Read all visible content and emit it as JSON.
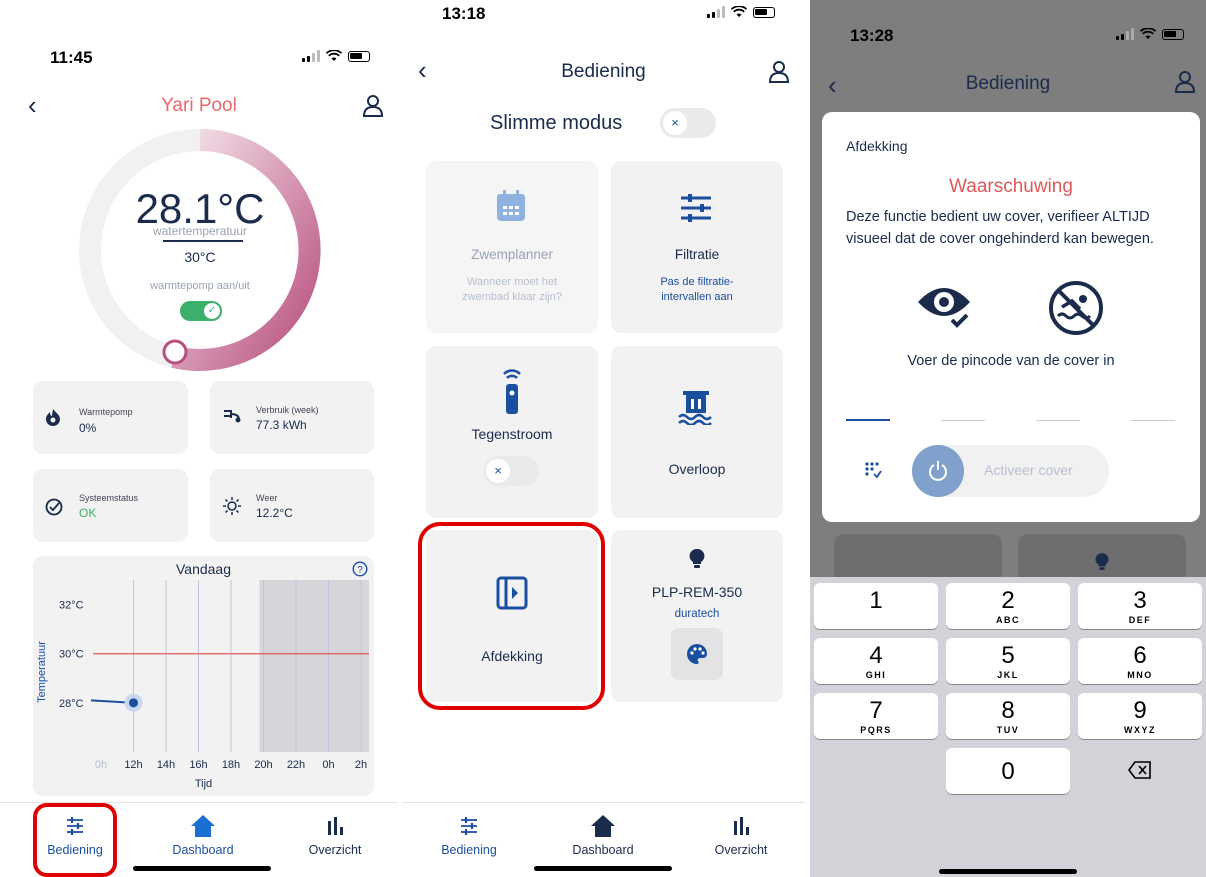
{
  "screen1": {
    "time": "11:45",
    "title": "Yari Pool",
    "temp": "28.1°C",
    "temp_label": "watertemperatuur",
    "setpoint": "30°C",
    "heatpump_label": "warmtepomp aan/uit",
    "tiles": [
      {
        "label": "Warmtepomp",
        "value": "0%"
      },
      {
        "label": "Verbruik (week)",
        "value": "77.3 kWh"
      },
      {
        "label": "Systeemstatus",
        "value": "OK"
      },
      {
        "label": "Weer",
        "value": "12.2°C"
      }
    ],
    "colors": {
      "title": "#e9686d",
      "ring": "#c05f8e",
      "toggle": "#3cb06b",
      "ok": "#3cb06b",
      "limit": "#e05858",
      "point": "#1a4fa0"
    },
    "chart_data": {
      "type": "line",
      "title": "Vandaag",
      "xlabel": "Tijd",
      "ylabel": "Temperatuur",
      "x_ticks": [
        "0h",
        "12h",
        "14h",
        "16h",
        "18h",
        "20h",
        "22h",
        "0h",
        "2h"
      ],
      "y_ticks": [
        "32°C",
        "30°C",
        "28°C"
      ],
      "ylim": [
        26,
        33
      ],
      "reference_line": {
        "value": 30,
        "label": "30°C"
      },
      "series": [
        {
          "x": [
            "0h",
            "12h"
          ],
          "values": [
            28.1,
            28.0
          ]
        }
      ],
      "shaded_from": "20h"
    },
    "tabs": [
      "Bediening",
      "Dashboard",
      "Overzicht"
    ]
  },
  "screen2": {
    "time": "13:18",
    "title": "Bediening",
    "smart_mode": "Slimme modus",
    "toggle_symbol": "×",
    "tiles": {
      "zwemplanner": {
        "title": "Zwemplanner",
        "sub": "Wanneer moet het zwembad klaar zijn?"
      },
      "filtratie": {
        "title": "Filtratie",
        "sub": "Pas de filtratie-intervallen aan"
      },
      "tegenstroom": {
        "title": "Tegenstroom"
      },
      "overloop": {
        "title": "Overloop"
      },
      "afdekking": {
        "title": "Afdekking"
      },
      "light": {
        "title": "PLP-REM-350",
        "sub": "duratech"
      }
    },
    "tabs": [
      "Bediening",
      "Dashboard",
      "Overzicht"
    ]
  },
  "screen3": {
    "time": "13:28",
    "title": "Bediening",
    "dialog": {
      "heading": "Afdekking",
      "warning": "Waarschuwing",
      "body": "Deze functie bedient uw cover, verifieer ALTIJD visueel dat de cover ongehinderd kan bewegen.",
      "pin_prompt": "Voer de pincode van de cover in",
      "activate": "Activeer cover"
    },
    "keypad": [
      {
        "n": "1",
        "l": ""
      },
      {
        "n": "2",
        "l": "ABC"
      },
      {
        "n": "3",
        "l": "DEF"
      },
      {
        "n": "4",
        "l": "GHI"
      },
      {
        "n": "5",
        "l": "JKL"
      },
      {
        "n": "6",
        "l": "MNO"
      },
      {
        "n": "7",
        "l": "PQRS"
      },
      {
        "n": "8",
        "l": "TUV"
      },
      {
        "n": "9",
        "l": "WXYZ"
      },
      {
        "n": "0",
        "l": ""
      }
    ]
  }
}
